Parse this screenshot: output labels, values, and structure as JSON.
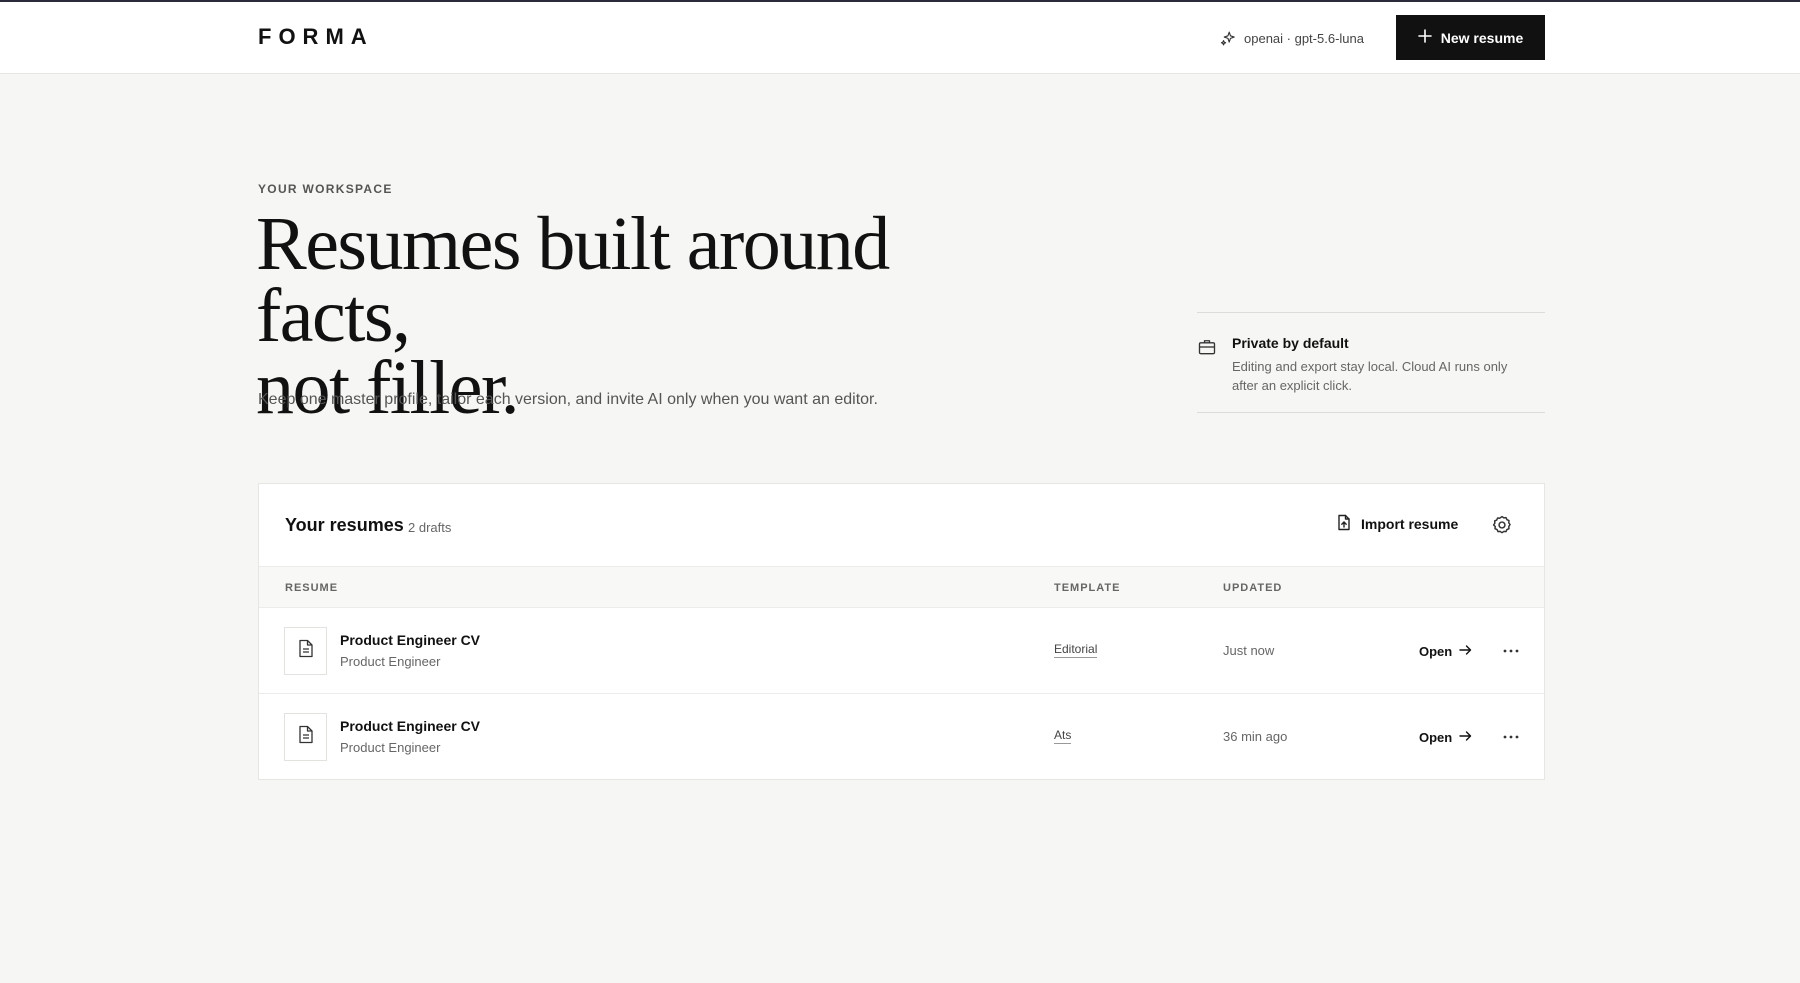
{
  "header": {
    "logo": "FORMA",
    "model": "openai · gpt-5.6-luna",
    "new_button": "New resume"
  },
  "hero": {
    "eyebrow": "YOUR WORKSPACE",
    "headline_line1": "Resumes built around facts,",
    "headline_line2": "not filler.",
    "subhead": "Keep one master profile, tailor each version, and invite AI only when you want an editor."
  },
  "privacy": {
    "title": "Private by default",
    "description": "Editing and export stay local. Cloud AI runs only after an explicit click."
  },
  "resumes": {
    "title": "Your resumes",
    "count": "2 drafts",
    "import_label": "Import resume",
    "columns": [
      "RESUME",
      "TEMPLATE",
      "UPDATED"
    ],
    "rows": [
      {
        "title": "Product Engineer CV",
        "subtitle": "Product Engineer",
        "template": "Editorial",
        "updated": "Just now",
        "action": "Open"
      },
      {
        "title": "Product Engineer CV",
        "subtitle": "Product Engineer",
        "template": "Ats",
        "updated": "36 min ago",
        "action": "Open"
      }
    ]
  },
  "icons": {
    "model": "sparkle-icon",
    "new": "plus-icon",
    "privacy": "briefcase-icon",
    "import": "file-upload-icon",
    "settings": "gear-icon",
    "document": "document-icon",
    "open": "arrow-right-icon",
    "more": "more-horizontal-icon"
  },
  "colors": {
    "background": "#f6f6f4",
    "surface": "#ffffff",
    "primary": "#111111",
    "muted": "#666666"
  }
}
